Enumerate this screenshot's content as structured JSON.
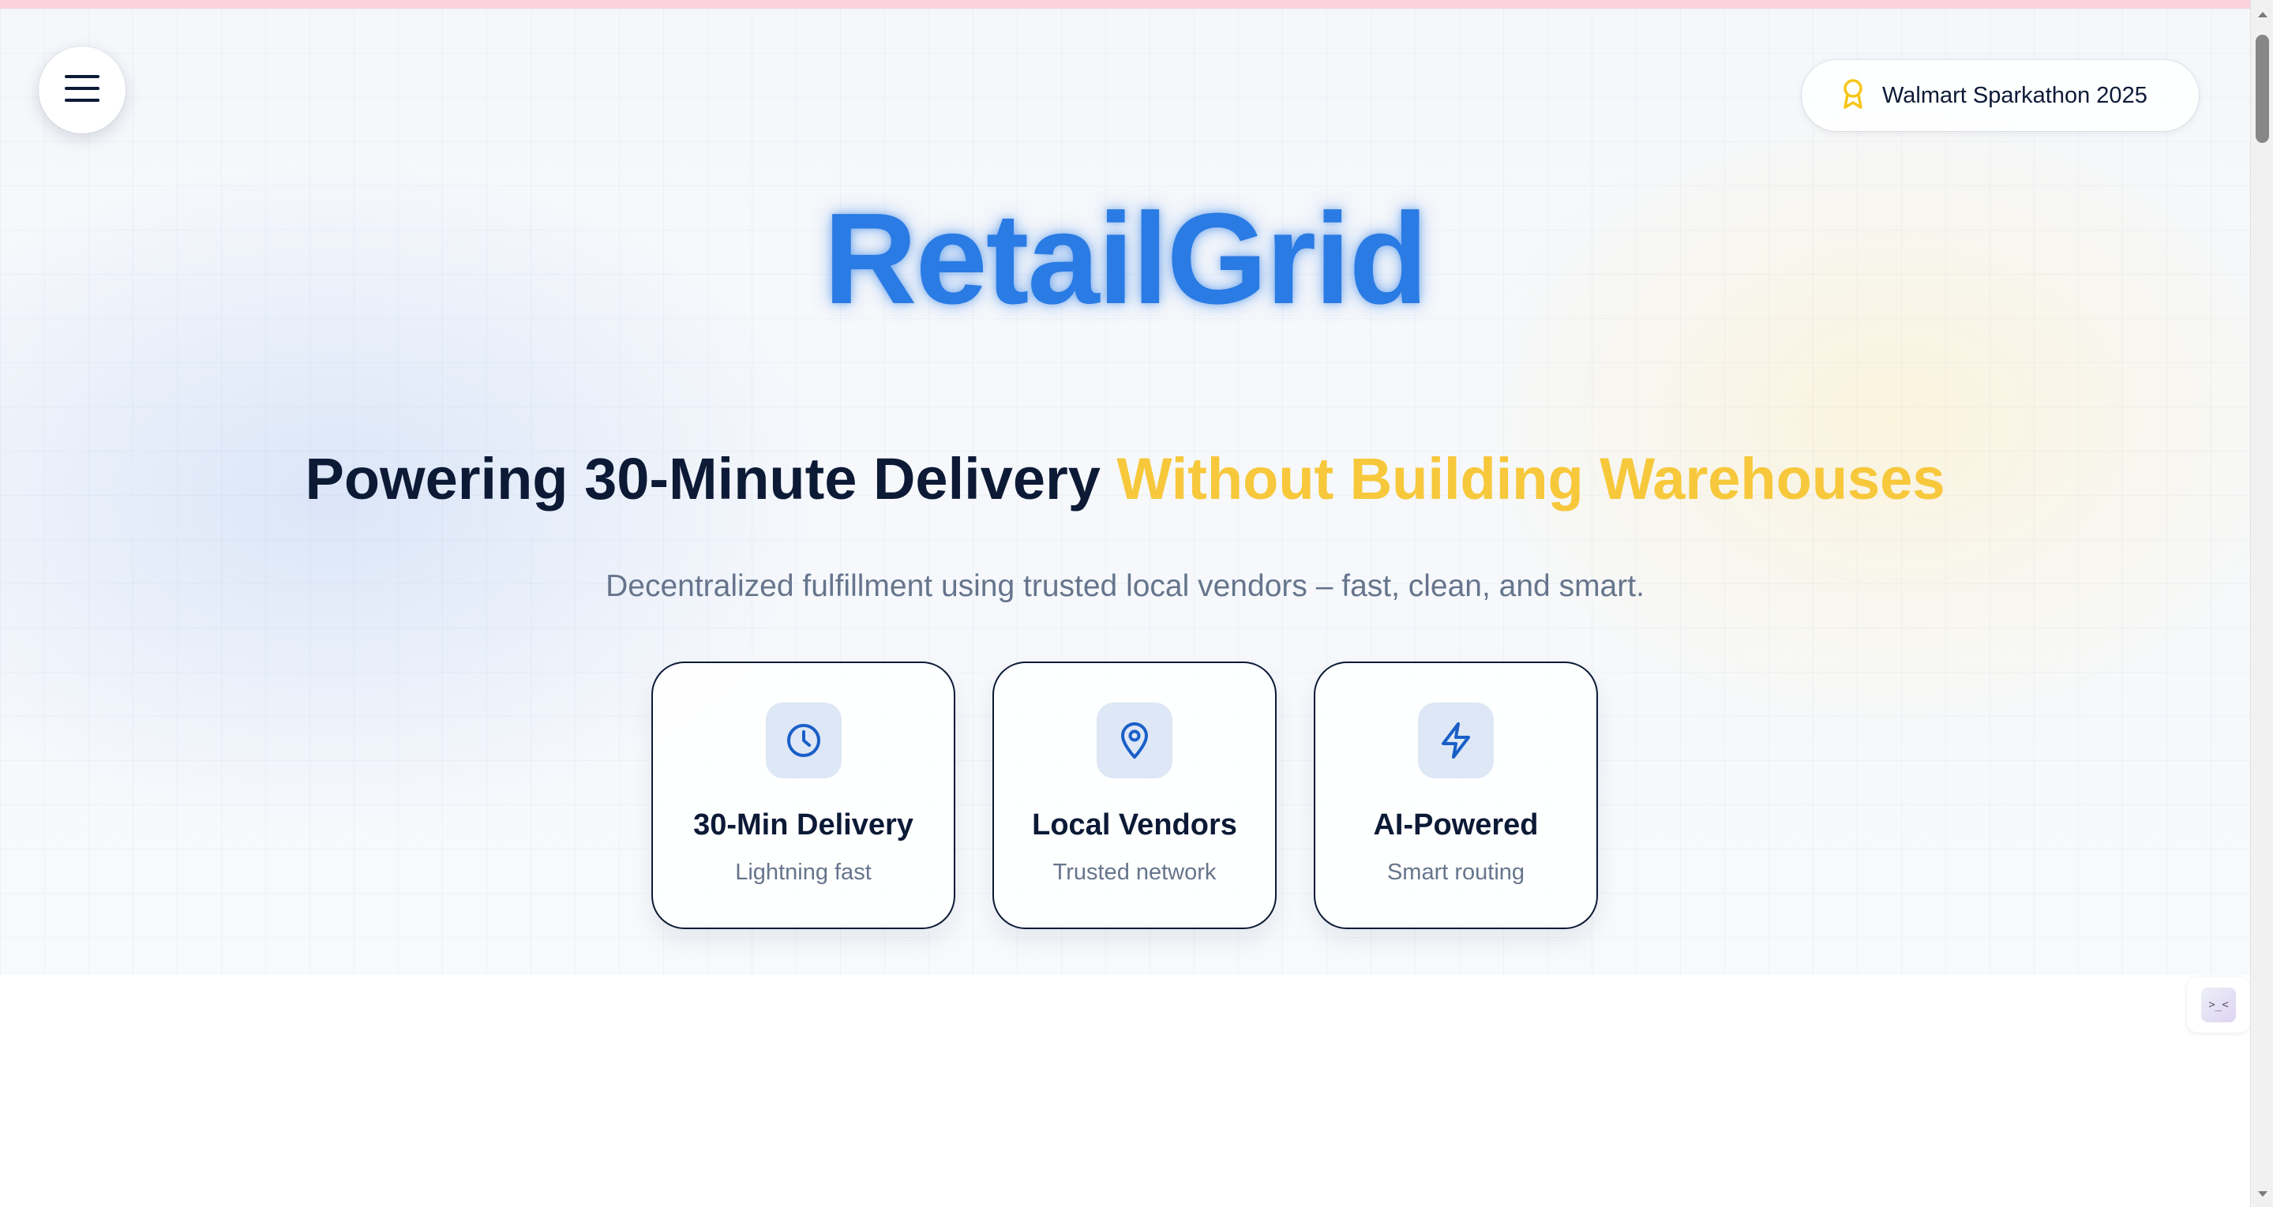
{
  "header": {
    "menu_icon": "hamburger-menu-icon",
    "badge": {
      "icon": "award-icon",
      "label": "Walmart Sparkathon 2025",
      "icon_color": "#f5c518"
    }
  },
  "hero": {
    "logo": "RetailGrid",
    "headline_main": "Powering 30-Minute Delivery",
    "headline_accent": "Without Building Warehouses",
    "subheading": "Decentralized fulfillment using trusted local vendors – fast, clean, and smart.",
    "features": [
      {
        "icon": "clock-icon",
        "title": "30-Min Delivery",
        "subtitle": "Lightning fast"
      },
      {
        "icon": "map-pin-icon",
        "title": "Local Vendors",
        "subtitle": "Trusted network"
      },
      {
        "icon": "lightning-icon",
        "title": "AI-Powered",
        "subtitle": "Smart routing"
      }
    ]
  },
  "dev_widget": {
    "icon": "dev-toolbar-icon",
    "glyph": ">_<"
  },
  "colors": {
    "brand_blue": "#2a7be4",
    "accent_yellow": "#f7c83b",
    "navy_text": "#0c1a36",
    "muted_text": "#66758c",
    "icon_blue": "#1a5fc8",
    "top_strip": "#fbd3dc"
  }
}
